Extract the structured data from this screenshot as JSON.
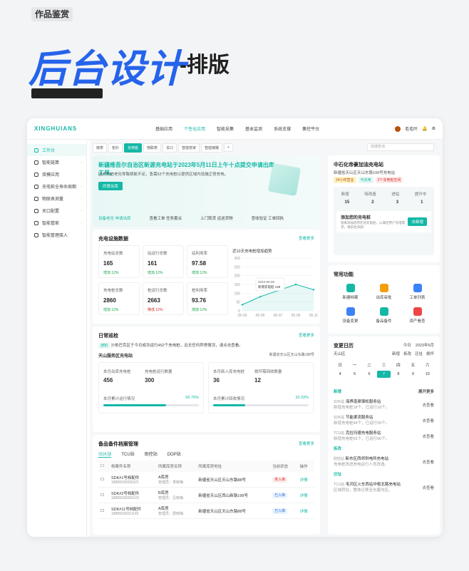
{
  "header": {
    "tag": "作品鉴赏",
    "title": "后台设计",
    "subtitle": "-排版"
  },
  "app": {
    "logo": "XINGHUIANS",
    "nav": [
      "基础应用",
      "个性化应用",
      "智能采集",
      "基本监测",
      "系统支撑",
      "集控平台"
    ],
    "user": "毛毛叶"
  },
  "sidebar": [
    "工作台",
    "智能链算",
    "双模应用",
    "充电桩全寿命周期",
    "物联表测量",
    "关口配置",
    "智能管家",
    "智能管理接入"
  ],
  "tabs": [
    "链表",
    "拓扑",
    "充电桩",
    "物联表",
    "关口",
    "智能管家",
    "智能链路"
  ],
  "search_placeholder": "快捷查询",
  "banner": {
    "title": "新疆维吾尔自治区新源充电站于2023年5月11日上午十点提交申请出库工单。",
    "desc": "因充电桩老化导致续航不足，急需53个充电桩以提供区域内设施正常充电。",
    "btn": "同意出库",
    "links": [
      "设备老化 申请出库",
      "查看工单 任务委派",
      "上门取货 运送货物",
      "查收验证 工单回执"
    ]
  },
  "charging": {
    "title": "充电设施数据",
    "more": "查看更多",
    "time": "更新时间：2023-05-11 10:00:00",
    "stats": [
      {
        "l": "充电站总数",
        "v": "165",
        "c": "增加 12%"
      },
      {
        "l": "站运行总数",
        "v": "161",
        "c": "增加 12%"
      },
      {
        "l": "站利用率",
        "v": "97.58",
        "c": "增加 12%"
      },
      {
        "l": "充电桩总数",
        "v": "2860",
        "c": "增加 12%"
      },
      {
        "l": "桩运行总数",
        "v": "2663",
        "c": "降低 12%"
      },
      {
        "l": "桩利用率",
        "v": "93.76",
        "c": "增加 12%"
      }
    ]
  },
  "chart_data": {
    "type": "line",
    "title": "近10天充电桩增加趋势",
    "x": [
      "05-03",
      "05-05",
      "05-07",
      "05-09",
      "05-11"
    ],
    "y": [
      35,
      80,
      115,
      150,
      120
    ],
    "ylim": [
      0,
      300
    ],
    "yticks": [
      0,
      50,
      100,
      150,
      200,
      250,
      300
    ],
    "tooltip": {
      "date": "2023-05-05",
      "label": "新增充电桩",
      "value": "129"
    }
  },
  "inspection": {
    "title": "日常巡检",
    "time": "更新时间：2023-05-11 10:00:00",
    "more": "查看更多",
    "notice_tag": "通知",
    "notice": "沙依巴克区于今日成功运行452个充电桩，且无任何异常情况，请点击查看。",
    "station": "天山服务区充电站",
    "address": "新疆省天山区天山东路188号",
    "b1": {
      "l1": "本月出库充电桩",
      "v1": "456",
      "l2": "充电桩运行数量",
      "v2": "300",
      "pl": "本月累计运行情况",
      "pv": "65.79%"
    },
    "b2": {
      "l1": "本月新入库充电桩",
      "v1": "36",
      "l2": "损坏需回收数量",
      "v2": "12",
      "pl": "本月累计回收情况",
      "pv": "33.33%"
    }
  },
  "parts": {
    "title": "备品备件档案管理",
    "time": "更新时间：2023-05-11 10:00:00",
    "more": "查看更多",
    "tabs": [
      "SDK站",
      "TCU站",
      "助控站",
      "DOP站"
    ],
    "cols": [
      "档案件名称",
      "所属库房名称",
      "所属库房地址",
      "当前状态",
      "操作"
    ],
    "rows": [
      {
        "n": "SDK#1号档配件",
        "c": "18889230000321",
        "w": "A库房",
        "m": "管理员：李晓梅",
        "a": "新疆省天山区天山东路88号",
        "s": "未入库",
        "op": "详情"
      },
      {
        "n": "SDK#2号档配件",
        "c": "18889230000123",
        "w": "B库房",
        "m": "管理员：吕晓梅",
        "a": "新疆省天山区西山新路199号",
        "s": "已入库",
        "op": "详情"
      },
      {
        "n": "SDK#11号档配件",
        "c": "18889230021145",
        "w": "A库房",
        "m": "管理员：费晓梅",
        "a": "新疆省天山区天山东路88号",
        "s": "已入库",
        "op": "详情"
      }
    ]
  },
  "station": {
    "title": "中石化帝豪加油充电站",
    "addr": "新疆省天山区天山东路199号充电站",
    "tags": [
      "24小时营业",
      "可充电",
      "2个充电桩空闲"
    ],
    "labels": [
      "新增",
      "待改造",
      "进站",
      "提升中"
    ],
    "values": [
      "15",
      "2",
      "3",
      "1"
    ],
    "add_title": "添加您的充电桩",
    "add_desc": "快来添加您所在的充电桩，以满足用户充电需求，请前往添加！",
    "add_btn": "去新增"
  },
  "functions": {
    "title": "常用功能",
    "items": [
      "新建档案",
      "出库审批",
      "工单列表",
      "设备变更",
      "备品备件",
      "资产看查"
    ]
  },
  "calendar": {
    "title": "变更日历",
    "today": "今日",
    "month": "2023年5月",
    "region": "天山区",
    "legend": [
      "新增",
      "拆改",
      "迁址",
      "损坏"
    ],
    "week": [
      "日",
      "一",
      "二",
      "三",
      "四",
      "五",
      "六"
    ],
    "days": [
      "2",
      "3",
      "4",
      "5",
      "6",
      "7",
      "8",
      "9",
      "10"
    ],
    "sel": "7",
    "groups": [
      {
        "name": "新增",
        "items": [
          {
            "tag": "SDK站",
            "t": "海界南渠宿松服务站",
            "d": "新增充电桩18个，已运行18个。"
          },
          {
            "tag": "SDK站",
            "t": "节能渠流服务站",
            "d": "新增充电桩44个，已运行39个。"
          },
          {
            "tag": "TCU站",
            "t": "克拉玛德充电服务站",
            "d": "新增充电桩55个，已运行56个。"
          }
        ]
      },
      {
        "name": "拆改",
        "items": [
          {
            "tag": "助控站",
            "t": "新市区西郊供电所充电站",
            "d": "充电桩改进充电运行人员改造。"
          }
        ]
      },
      {
        "name": "迁址",
        "items": [
          {
            "tag": "TCU站",
            "t": "毛河区火车西站中枢北路充电站",
            "d": "区域转址，整体迁移至水磨沟区。"
          }
        ]
      }
    ],
    "expand": "展开更多",
    "view": "去查看"
  }
}
